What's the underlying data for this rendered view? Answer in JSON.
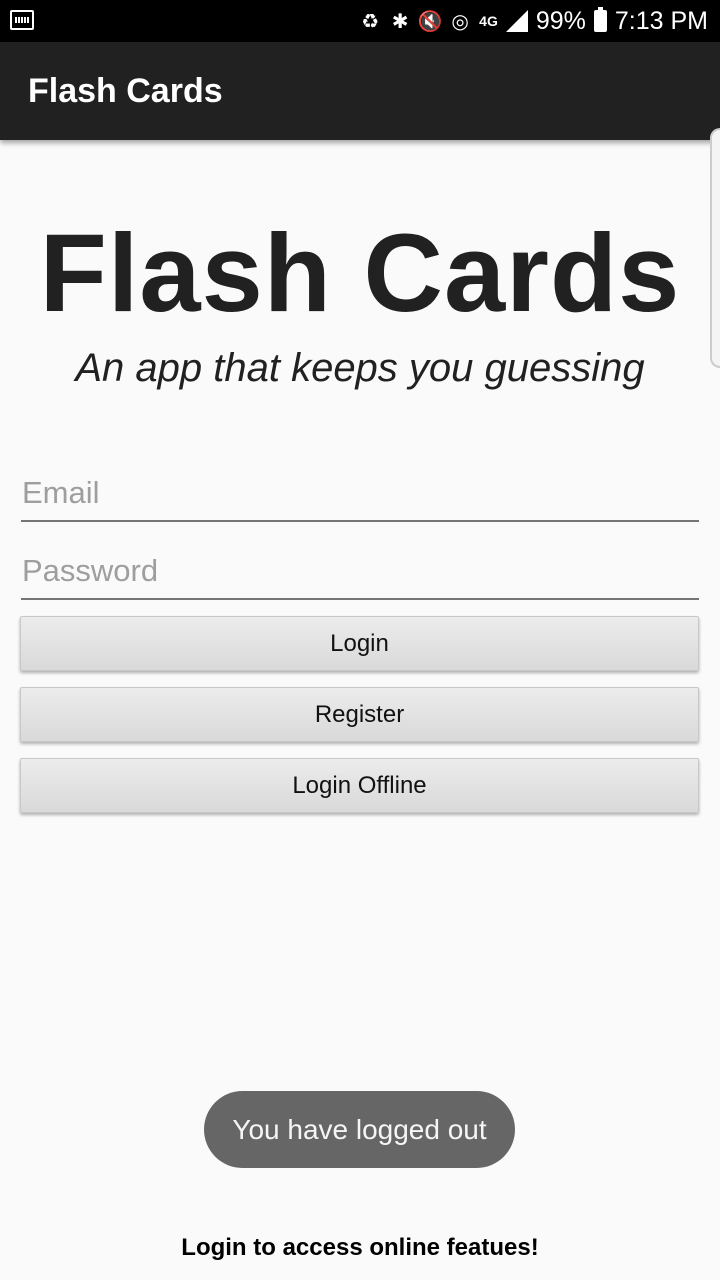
{
  "status_bar": {
    "battery_percent": "99%",
    "time": "7:13 PM",
    "network": "4G",
    "icons": [
      "screen-capture-icon",
      "battery-saver-icon",
      "bluetooth-icon",
      "mute-icon",
      "wifi-icon",
      "signal-icon",
      "battery-icon"
    ]
  },
  "app_bar": {
    "title": "Flash Cards"
  },
  "hero": {
    "title": "Flash Cards",
    "subtitle": "An app that keeps you guessing"
  },
  "form": {
    "email_placeholder": "Email",
    "email_value": "",
    "password_placeholder": "Password",
    "password_value": ""
  },
  "buttons": {
    "login": "Login",
    "register": "Register",
    "login_offline": "Login Offline"
  },
  "toast": {
    "message": "You have logged out"
  },
  "footer": {
    "text": "Login to access online featues!"
  },
  "colors": {
    "app_bar": "#212121",
    "background": "#fafafa",
    "toast": "#666666"
  }
}
